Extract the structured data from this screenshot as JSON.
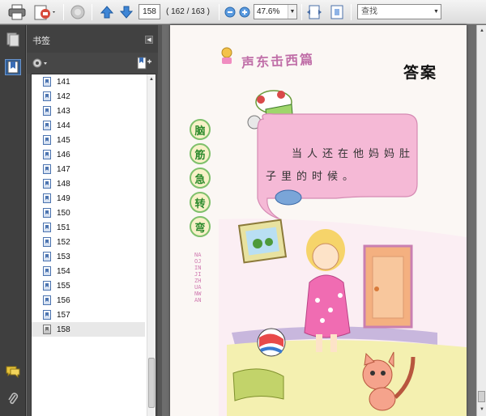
{
  "toolbar": {
    "page_number": "158",
    "page_count": "( 162 / 163 )",
    "zoom": "47.6%",
    "find_placeholder": "查找"
  },
  "panel": {
    "title": "书签"
  },
  "bookmarks": [
    {
      "label": "141"
    },
    {
      "label": "142"
    },
    {
      "label": "143"
    },
    {
      "label": "144"
    },
    {
      "label": "145"
    },
    {
      "label": "146"
    },
    {
      "label": "147"
    },
    {
      "label": "148"
    },
    {
      "label": "149"
    },
    {
      "label": "150"
    },
    {
      "label": "151"
    },
    {
      "label": "152"
    },
    {
      "label": "153"
    },
    {
      "label": "154"
    },
    {
      "label": "155"
    },
    {
      "label": "156"
    },
    {
      "label": "157"
    },
    {
      "label": "158"
    }
  ],
  "document": {
    "header_title": "声东击西篇",
    "answer_label": "答案",
    "side_title": [
      "脑",
      "筋",
      "急",
      "转",
      "弯"
    ],
    "side_small": "NAOJINJIZHUANWAN",
    "answer_line1": "当人还在他妈妈肚",
    "answer_line2": "子里的时候。"
  },
  "colors": {
    "accent": "#4c74b0",
    "bubble": "#f5b9d6",
    "panel_bg": "#4b4b4b"
  }
}
